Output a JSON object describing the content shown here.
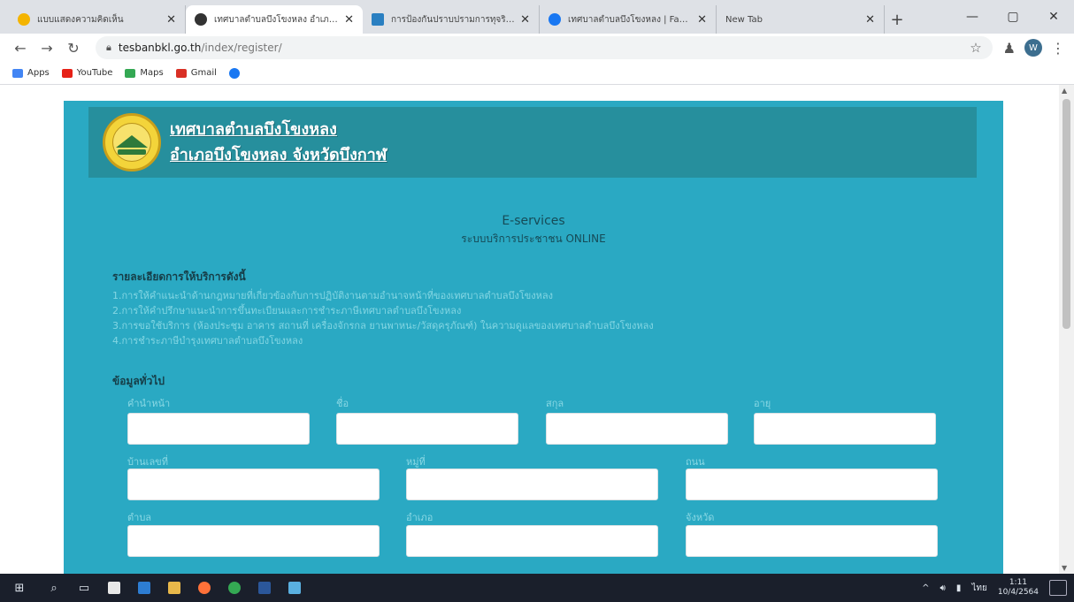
{
  "browser": {
    "tabs": [
      {
        "title": "แบบแสดงความคิดเห็น",
        "favicon_color": "#f4b400",
        "active": false
      },
      {
        "title": "เทศบาลตำบลบึงโขงหลง อำเภอบึงโขงหลง",
        "favicon_color": "#333333",
        "active": true
      },
      {
        "title": "การป้องกันปราบปรามการทุจริต/ฯ",
        "favicon_color": "#2a7fc1",
        "active": false
      },
      {
        "title": "เทศบาลตำบลบึงโขงหลง | Faceboo",
        "favicon_color": "#1877f2",
        "active": false
      },
      {
        "title": "New Tab",
        "favicon_color": "",
        "active": false
      }
    ],
    "url_host": "tesbanbkl.go.th",
    "url_path": "/index/register/",
    "avatar_letter": "W",
    "bookmarks": [
      {
        "label": "Apps",
        "color": "#4285f4"
      },
      {
        "label": "YouTube",
        "color": "#e62117"
      },
      {
        "label": "Maps",
        "color": "#34a853"
      },
      {
        "label": "Gmail",
        "color": "#d93025"
      },
      {
        "label": "",
        "color": "#1877f2"
      }
    ]
  },
  "page": {
    "org_name": "เทศบาลตำบลบึงโขงหลง",
    "org_location": "อำเภอบึงโขงหลง จังหวัดบึงกาฬ",
    "eservices_title": "E-services",
    "eservices_subtitle": "ระบบบริการประชาชน ONLINE",
    "services_heading": "รายละเอียดการให้บริการดังนี้",
    "services": [
      "1.การให้คำแนะนำด้านกฎหมายที่เกี่ยวข้องกับการปฏิบัติงานตามอำนาจหน้าที่ของเทศบาลตำบลบึงโขงหลง",
      "2.การให้คำปรึกษาแนะนำการขึ้นทะเบียนและการชำระภาษีเทศบาลตำบลบึงโขงหลง",
      "3.การขอใช้บริการ (ห้องประชุม อาคาร สถานที่ เครื่องจักรกล ยานพาหนะ/วัสดุครุภัณฑ์) ในความดูแลของเทศบาลตำบลบึงโขงหลง",
      "4.การชำระภาษีบำรุงเทศบาลตำบลบึงโขงหลง"
    ],
    "general_heading": "ข้อมูลทั่วไป",
    "form": {
      "row1": [
        "คำนำหน้า",
        "ชื่อ",
        "สกุล",
        "อายุ"
      ],
      "row2": [
        "บ้านเลขที่",
        "หมู่ที่",
        "ถนน"
      ],
      "row3": [
        "ตำบล",
        "อำเภอ",
        "จังหวัด"
      ]
    }
  },
  "taskbar": {
    "time": "1:11",
    "date": "10/4/2564",
    "lang": "ไทย"
  }
}
